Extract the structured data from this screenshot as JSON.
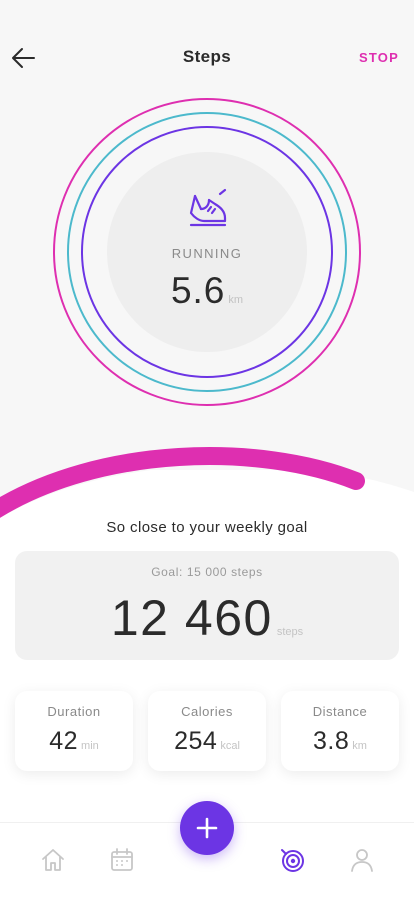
{
  "header": {
    "title": "Steps",
    "stop_label": "STOP",
    "back_icon": "arrow-left-icon"
  },
  "activity": {
    "mode": "RUNNING",
    "value": "5.6",
    "unit": "km"
  },
  "goal": {
    "message": "So close to your weekly goal",
    "label": "Goal: 15 000 steps",
    "value": "12 460",
    "unit": "steps",
    "progress": 0.83
  },
  "stats": [
    {
      "label": "Duration",
      "value": "42",
      "unit": "min"
    },
    {
      "label": "Calories",
      "value": "254",
      "unit": "kcal"
    },
    {
      "label": "Distance",
      "value": "3.8",
      "unit": "km"
    }
  ],
  "nav": {
    "items": [
      "home-icon",
      "calendar-icon",
      "activity-target-icon",
      "profile-icon"
    ],
    "active": "activity-target-icon",
    "fab_icon": "plus-icon"
  },
  "colors": {
    "accent_pink": "#de2fb0",
    "accent_teal": "#4cb9cc",
    "accent_purple": "#6c35e4",
    "text": "#2b2b2b",
    "muted": "#8a8a8a"
  }
}
